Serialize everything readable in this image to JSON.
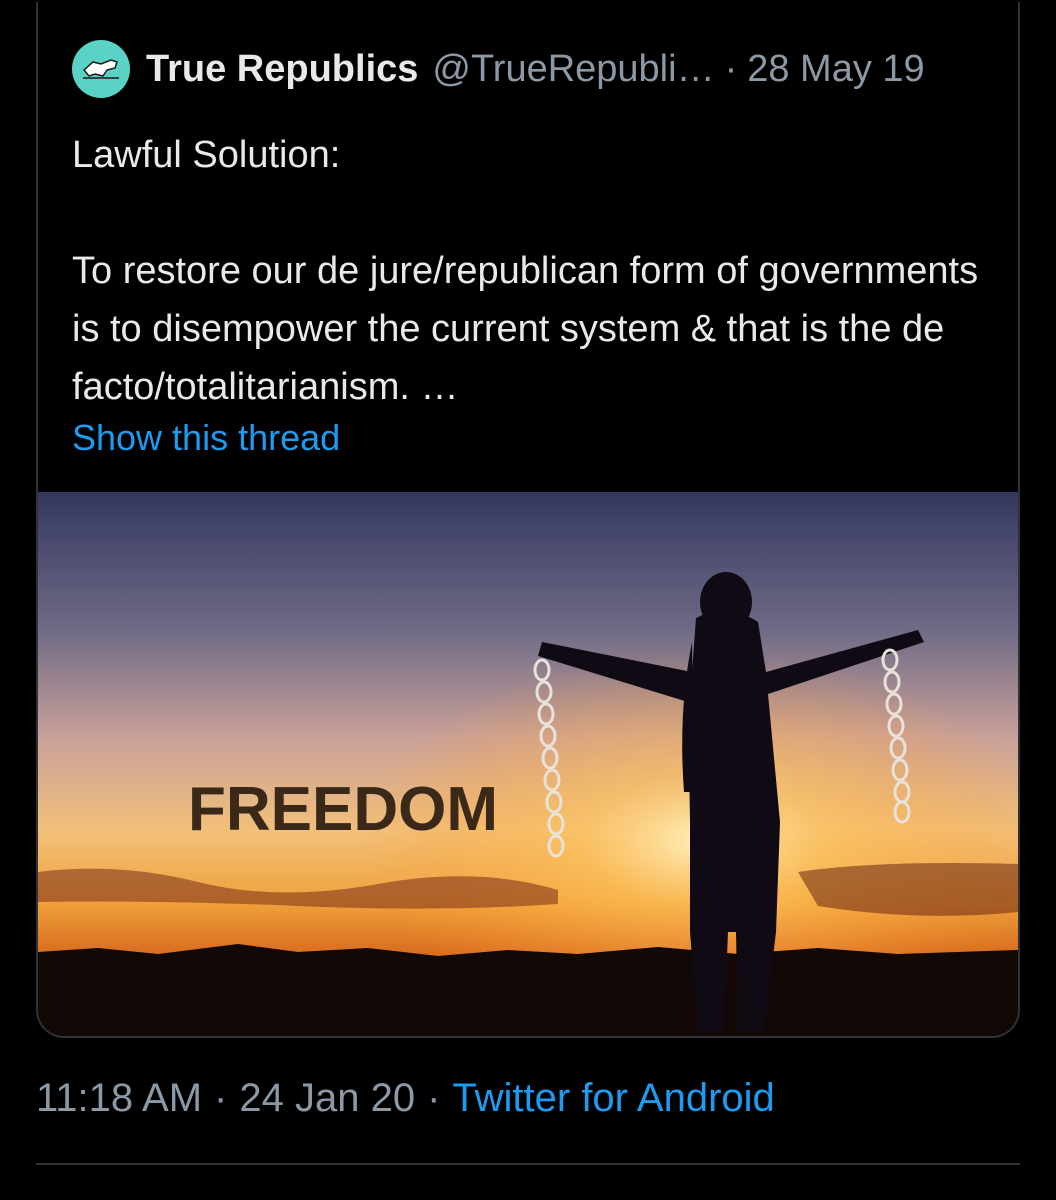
{
  "quoted_tweet": {
    "display_name": "True Republics",
    "handle": "@TrueRepubli…",
    "separator": "·",
    "date": "28 May 19",
    "text_line_1": "Lawful Solution:",
    "text_line_2": "To restore our de jure/republican form of governments is to disempower the current system & that is the de facto/totalitarianism. …",
    "show_thread": "Show this thread",
    "media": {
      "overlay_text": "FREEDOM"
    }
  },
  "meta": {
    "time": "11:18 AM",
    "separator": "·",
    "date": "24 Jan 20",
    "source": "Twitter for Android"
  },
  "colors": {
    "background": "#000000",
    "text": "#e7e9ea",
    "muted": "#8b98a5",
    "link": "#1d9bf0",
    "avatar": "#5ad2c6",
    "border": "#2f3336"
  }
}
